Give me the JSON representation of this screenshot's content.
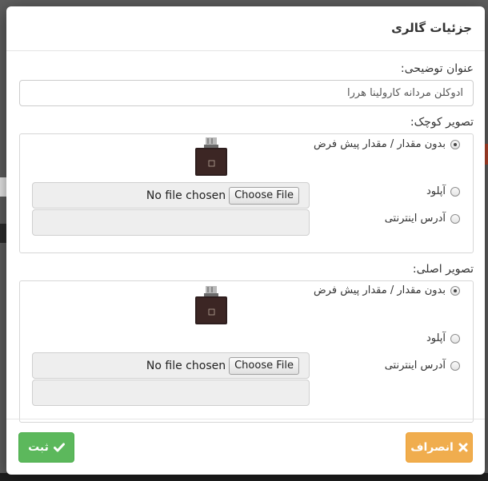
{
  "modal": {
    "title": "جزئیات گالری"
  },
  "description": {
    "label": "عنوان توضیحی:",
    "value": "ادوکلن مردانه کارولینا هررا"
  },
  "thumbnail_image": {
    "label": "تصویر کوچک:",
    "options": [
      {
        "label": "بدون مقدار / مقدار پیش فرض",
        "checked": true
      },
      {
        "label": "آپلود",
        "checked": false
      },
      {
        "label": "آدرس اینترنتی",
        "checked": false
      }
    ],
    "file_button_label": "Choose File",
    "file_status": "No file chosen",
    "url_value": ""
  },
  "main_image": {
    "label": "تصویر اصلی:",
    "options": [
      {
        "label": "بدون مقدار / مقدار پیش فرض",
        "checked": true
      },
      {
        "label": "آپلود",
        "checked": false
      },
      {
        "label": "آدرس اینترنتی",
        "checked": false
      }
    ],
    "file_button_label": "Choose File",
    "file_status": "No file chosen",
    "url_value": ""
  },
  "footer": {
    "cancel_label": "انصراف",
    "submit_label": "ثبت"
  },
  "icons": {
    "cancel": "close-icon",
    "submit": "check-icon"
  },
  "colors": {
    "cancel_button": "#f0ad4e",
    "submit_button": "#5cb85c"
  }
}
